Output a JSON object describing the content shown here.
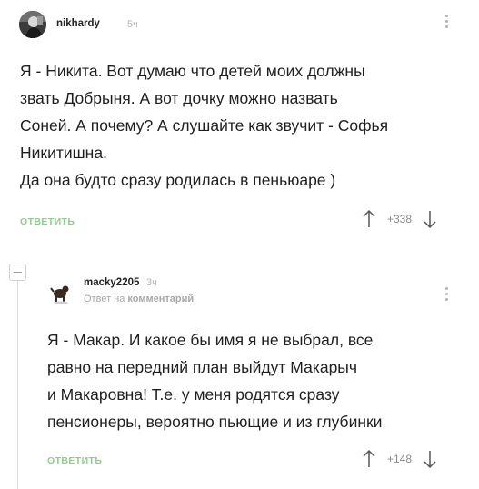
{
  "comments": [
    {
      "username": "nikhardy",
      "time": "5ч",
      "reply_to": null,
      "text_lines": [
        "Я - Никита. Вот думаю что детей моих должны",
        "звать Добрыня. А вот дочку можно назвать",
        "Соней. А почему? А слушайте как звучит - Софья",
        "Никитишна.",
        "Да она будто сразу родилась в пеньюаре )"
      ],
      "reply_label": "ОТВЕТИТЬ",
      "rating": "+338",
      "avatar_icon": "user-avatar-icon"
    },
    {
      "username": "macky2205",
      "time": "3ч",
      "reply_to": {
        "prefix": "Ответ на",
        "target": "комментарий"
      },
      "text_lines": [
        "Я - Макар. И какое бы имя я не выбрал, все",
        "равно на передний план выйдут Макарыч",
        "и Макаровна! Т.е. у меня родятся сразу",
        "пенсионеры, вероятно пьющие и из глубинки"
      ],
      "reply_label": "ОТВЕТИТЬ",
      "rating": "+148",
      "avatar_icon": "dog-avatar-icon"
    }
  ],
  "colors": {
    "reply": "#8fcd8d",
    "muted": "#b5b5b5",
    "text": "#1f1f1f"
  }
}
